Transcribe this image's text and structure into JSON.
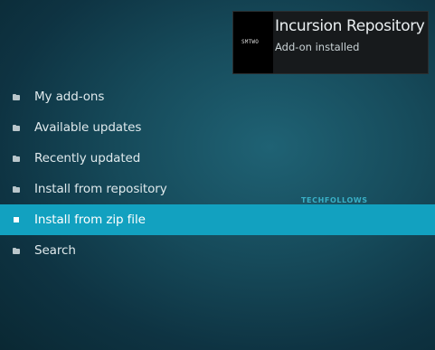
{
  "notification": {
    "thumbnail_text": "SMTWO",
    "title": "Incursion Repository",
    "subtitle": "Add-on installed"
  },
  "menu": {
    "items": [
      {
        "label": "My add-ons",
        "icon": "folder-icon",
        "active": false
      },
      {
        "label": "Available updates",
        "icon": "folder-icon",
        "active": false
      },
      {
        "label": "Recently updated",
        "icon": "folder-icon",
        "active": false
      },
      {
        "label": "Install from repository",
        "icon": "folder-icon",
        "active": false
      },
      {
        "label": "Install from zip file",
        "icon": "square-icon",
        "active": true
      },
      {
        "label": "Search",
        "icon": "folder-icon",
        "active": false
      }
    ]
  },
  "watermark": "TECHFOLLOWS",
  "colors": {
    "background": "#164a5a",
    "highlight": "#12a1c0",
    "notification_bg": "#171a1c",
    "watermark": "#3fc0d8"
  }
}
